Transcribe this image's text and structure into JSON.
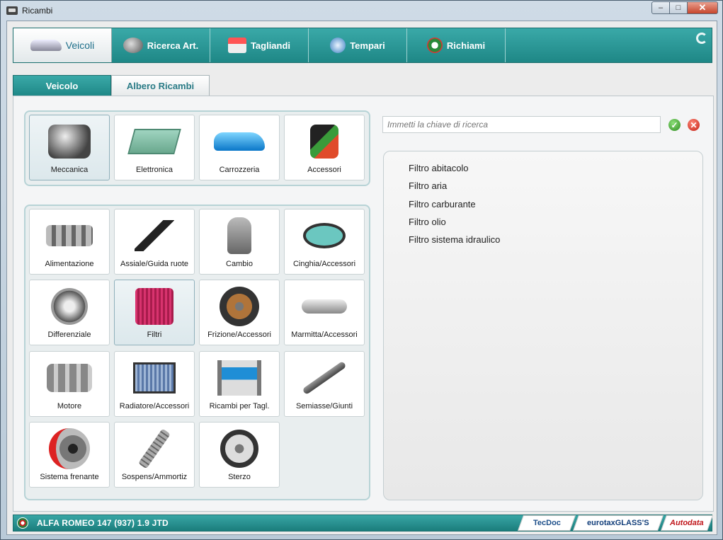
{
  "window": {
    "title": "Ricambi"
  },
  "nav": {
    "tabs": [
      {
        "label": "Veicoli",
        "icon": "car-icon",
        "active": true
      },
      {
        "label": "Ricerca Art.",
        "icon": "search-parts-icon",
        "active": false
      },
      {
        "label": "Tagliandi",
        "icon": "service-icon",
        "active": false
      },
      {
        "label": "Tempari",
        "icon": "clock-icon",
        "active": false
      },
      {
        "label": "Richiami",
        "icon": "recall-icon",
        "active": false
      }
    ]
  },
  "subtabs": [
    {
      "label": "Veicolo",
      "active": true
    },
    {
      "label": "Albero Ricambi",
      "active": false
    }
  ],
  "categories": [
    {
      "label": "Meccanica",
      "icon": "engine-icon",
      "selected": true
    },
    {
      "label": "Elettronica",
      "icon": "ecu-icon",
      "selected": false
    },
    {
      "label": "Carrozzeria",
      "icon": "car-body-icon",
      "selected": false
    },
    {
      "label": "Accessori",
      "icon": "accessory-icon",
      "selected": false
    }
  ],
  "subcategories": [
    {
      "label": "Alimentazione",
      "icon": "injector-icon"
    },
    {
      "label": "Assiale/Guida ruote",
      "icon": "control-arm-icon"
    },
    {
      "label": "Cambio",
      "icon": "gear-lever-icon"
    },
    {
      "label": "Cinghia/Accessori",
      "icon": "belt-icon"
    },
    {
      "label": "Differenziale",
      "icon": "differential-icon"
    },
    {
      "label": "Filtri",
      "icon": "filter-icon",
      "selected": true
    },
    {
      "label": "Frizione/Accessori",
      "icon": "clutch-icon"
    },
    {
      "label": "Marmitta/Accessori",
      "icon": "muffler-icon"
    },
    {
      "label": "Motore",
      "icon": "crankshaft-icon"
    },
    {
      "label": "Radiatore/Accessori",
      "icon": "radiator-icon"
    },
    {
      "label": "Ricambi per Tagl.",
      "icon": "lift-icon"
    },
    {
      "label": "Semiasse/Giunti",
      "icon": "axle-icon"
    },
    {
      "label": "Sistema frenante",
      "icon": "brake-icon"
    },
    {
      "label": "Sospens/Ammortiz",
      "icon": "shock-absorber-icon"
    },
    {
      "label": "Sterzo",
      "icon": "steering-wheel-icon"
    }
  ],
  "search": {
    "placeholder": "Immetti la chiave di ricerca"
  },
  "results": [
    "Filtro abitacolo",
    "Filtro aria",
    "Filtro carburante",
    "Filtro olio",
    "Filtro sistema idraulico"
  ],
  "footer": {
    "vehicle": "ALFA ROMEO  147 (937)  1.9 JTD",
    "partners": [
      "TecDoc",
      "eurotaxGLASS'S",
      "Autodata"
    ]
  },
  "colors": {
    "accent": "#1e8786",
    "accent_light": "#3aa9a8",
    "footer": "#1b7d7c"
  }
}
